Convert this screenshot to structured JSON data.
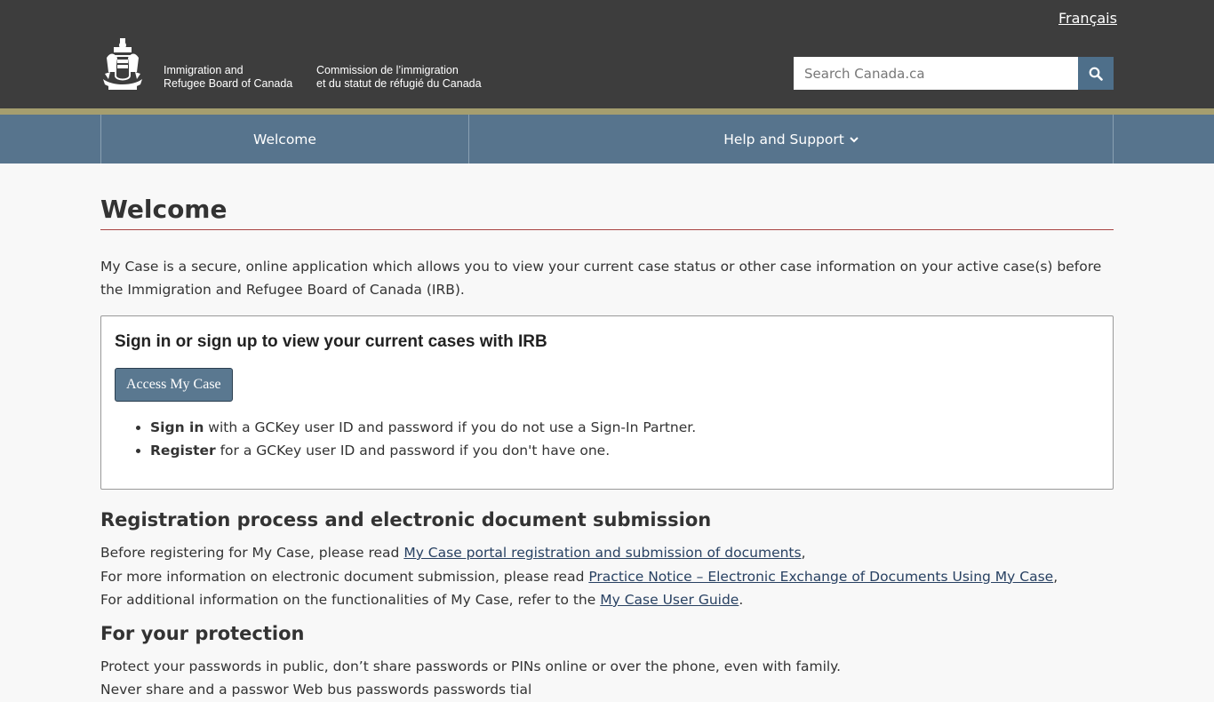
{
  "header": {
    "language_link": "Français",
    "signature_en_line1": "Immigration and",
    "signature_en_line2": "Refugee Board of Canada",
    "signature_fr_line1": "Commission de l’immigration",
    "signature_fr_line2": "et du statut de réfugié du Canada",
    "search_placeholder": "Search Canada.ca",
    "search_icon": "search-icon",
    "crest_icon": "coat-of-arms-icon"
  },
  "nav": {
    "welcome": "Welcome",
    "help": "Help and Support"
  },
  "main": {
    "title": "Welcome",
    "intro": "My Case is a secure, online application which allows you to view your current case status or other case information on your active case(s) before the Immigration and Refugee Board of Canada (IRB).",
    "panel": {
      "title": "Sign in or sign up to view your current cases with IRB",
      "button": "Access My Case",
      "items": [
        {
          "bold": "Sign in",
          "text": " with a GCKey user ID and password if you do not use a Sign-In Partner."
        },
        {
          "bold": "Register",
          "text": " for a GCKey user ID and password if you don't have one."
        }
      ]
    },
    "registration": {
      "heading": "Registration process and electronic document submission",
      "line1_pre": "Before registering for My Case, please read ",
      "line1_link": "My Case portal registration and submission of documents",
      "line1_post": ",",
      "line2_pre": "For more information on electronic document submission, please read ",
      "line2_link": "Practice Notice – Electronic Exchange of Documents Using My Case",
      "line2_post": ",",
      "line3_pre": "For additional information on the functionalities of My Case, refer to the ",
      "line3_link": "My Case User Guide",
      "line3_post": "."
    },
    "protection": {
      "heading": "For your protection",
      "line1": "Protect your passwords in public, don’t share passwords or PINs online or over the phone, even with family.",
      "line2": "Never share and a passwor Web bus passwords passwords tial"
    }
  },
  "colors": {
    "topbar": "#3d3d3d",
    "gold": "#a59e6f",
    "nav": "#57748d",
    "title_rule": "#a94442",
    "link": "#284162"
  }
}
